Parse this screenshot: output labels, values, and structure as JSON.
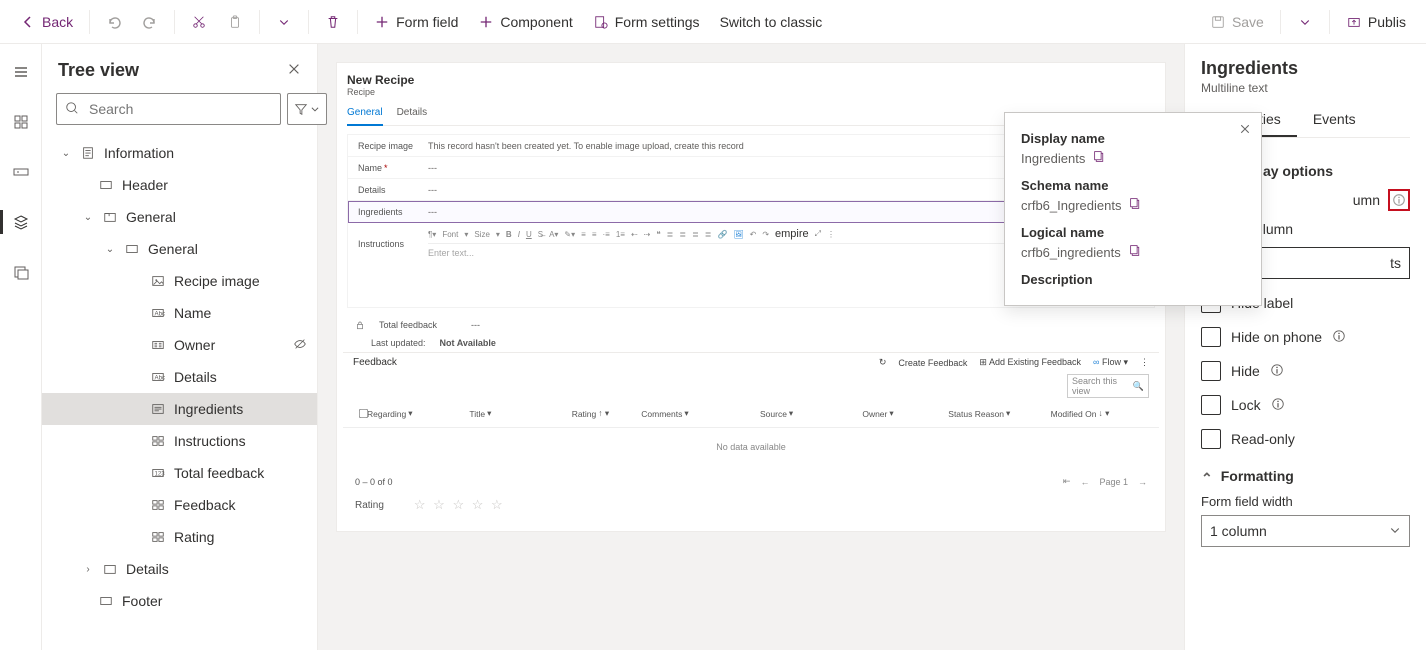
{
  "cmdbar": {
    "back": "Back",
    "form_field": "Form field",
    "component": "Component",
    "form_settings": "Form settings",
    "switch_classic": "Switch to classic",
    "save": "Save",
    "publish": "Publis"
  },
  "tree": {
    "title": "Tree view",
    "search_placeholder": "Search",
    "nodes": {
      "information": "Information",
      "header": "Header",
      "general": "General",
      "general_inner": "General",
      "recipe_image": "Recipe image",
      "name": "Name",
      "owner": "Owner",
      "details": "Details",
      "ingredients": "Ingredients",
      "instructions": "Instructions",
      "total_feedback": "Total feedback",
      "feedback": "Feedback",
      "rating": "Rating",
      "details_section": "Details",
      "footer": "Footer"
    }
  },
  "form": {
    "title": "New Recipe",
    "subtitle": "Recipe",
    "tabs": {
      "general": "General",
      "details": "Details"
    },
    "fields": {
      "recipe_image": "Recipe image",
      "recipe_image_msg": "This record hasn't been created yet. To enable image upload, create this record",
      "name": "Name",
      "details": "Details",
      "ingredients": "Ingredients",
      "instructions": "Instructions",
      "dash": "---",
      "enter_text": "Enter text..."
    },
    "rte": {
      "font": "Font",
      "size": "Size"
    },
    "footer": {
      "total_feedback": "Total feedback",
      "last_updated": "Last updated:",
      "not_available": "Not Available"
    },
    "feedback": {
      "label": "Feedback",
      "create": "Create Feedback",
      "add_existing": "Add Existing Feedback",
      "flow": "Flow",
      "search": "Search this view",
      "cols": {
        "regarding": "Regarding",
        "title": "Title",
        "rating": "Rating",
        "comments": "Comments",
        "source": "Source",
        "owner": "Owner",
        "status_reason": "Status Reason",
        "modified_on": "Modified On"
      },
      "no_data": "No data available",
      "pager_range": "0 – 0 of 0",
      "pager_page": "Page 1"
    },
    "rating_label": "Rating"
  },
  "popover": {
    "display_name_label": "Display name",
    "display_name_value": "Ingredients",
    "schema_name_label": "Schema name",
    "schema_name_value": "crfb6_Ingredients",
    "logical_name_label": "Logical name",
    "logical_name_value": "crfb6_ingredients",
    "description_label": "Description"
  },
  "props": {
    "title": "Ingredients",
    "subtitle": "Multiline text",
    "tabs": {
      "properties": "Properties",
      "events": "Events"
    },
    "display_options": "ay options",
    "column_suffix": "umn",
    "table_column": "able column",
    "input_suffix_value": "ts",
    "hide_label": "Hide label",
    "hide_on_phone": "Hide on phone",
    "hide": "Hide",
    "lock": "Lock",
    "read_only": "Read-only",
    "formatting": "Formatting",
    "form_field_width": "Form field width",
    "width_value": "1 column"
  }
}
